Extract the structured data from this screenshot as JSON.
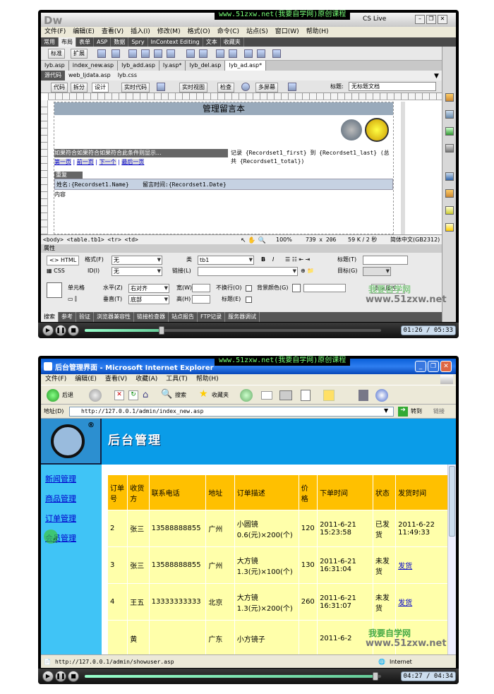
{
  "banner": "www.51zxw.net(我要自学网)原创课程",
  "watermark_url": "www.51zxw.net",
  "watermark_name": "我要自学网",
  "dw": {
    "logo": "Dw",
    "cslive": "CS Live",
    "menu": [
      "文件(F)",
      "编辑(E)",
      "查看(V)",
      "插入(I)",
      "修改(M)",
      "格式(O)",
      "命令(C)",
      "站点(S)",
      "窗口(W)",
      "帮助(H)"
    ],
    "insert_tabs": [
      "常用",
      "布局",
      "表单",
      "ASP",
      "数据",
      "Spry",
      "InContext Editing",
      "文本",
      "收藏夹"
    ],
    "tool_standard": "标准",
    "tool_extend": "扩展",
    "doc_tabs": [
      "lyb.asp",
      "index_new.asp",
      "lyb_add.asp",
      "ly.asp*",
      "lyb_del.asp",
      "lyb_ad.asp*"
    ],
    "doc_path": "源代码",
    "related": [
      "web_ljdata.asp",
      "lyb.css"
    ],
    "view_buttons": [
      "代码",
      "拆分",
      "设计",
      "实时代码",
      "实时视图",
      "检查",
      "多屏幕"
    ],
    "title_label": "标题:",
    "title_value": "无标题文档",
    "design": {
      "heading": "管理留言本",
      "repeat_text": "如果符合如果符合如果符合此条件则显示...",
      "nav_links": [
        "第一页",
        "前一页",
        "下一个",
        "最后一页"
      ],
      "record_text": "记录 {Recordset1_first} 到 {Recordset1_last} (总共 {Recordset1_total})",
      "repeat_label": "重复",
      "name_field": "姓名:{Recordset1.Name}",
      "time_field": "留言时间:{Recordset1.Date}",
      "content_label": "内容"
    },
    "tag_path": "<body> <table.tb1> <tr> <td>",
    "status": "100%",
    "size": "739 x 206",
    "filesize": "59 K / 2 秒",
    "encoding": "简体中文(GB2312)",
    "props_title": "属性",
    "props": {
      "html": "HTML",
      "css": "CSS",
      "format_label": "格式(F)",
      "format_value": "无",
      "class_label": "类",
      "class_value": "tb1",
      "id_label": "ID(I)",
      "id_value": "无",
      "link_label": "链接(L)",
      "title_label": "标题(T)",
      "target_label": "目标(G)",
      "cell_label": "单元格",
      "halign_label": "水平(Z)",
      "halign_value": "右对齐",
      "valign_label": "垂直(T)",
      "valign_value": "底部",
      "width_label": "宽(W)",
      "height_label": "高(H)",
      "nowrap_label": "不换行(O)",
      "header_label": "标题(E)",
      "bg_label": "背景颜色(G)",
      "page_props": "页面属性..."
    },
    "bottom_tabs": [
      "搜索",
      "参考",
      "验证",
      "浏览器兼容性",
      "链接检查器",
      "站点报告",
      "FTP记录",
      "服务器调试"
    ],
    "time": "01:26 / 05:33",
    "progress": 0.26
  },
  "ie": {
    "title": "后台管理界面 - Microsoft Internet Explorer",
    "menu": [
      "文件(F)",
      "编辑(E)",
      "查看(V)",
      "收藏(A)",
      "工具(T)",
      "帮助(H)"
    ],
    "back": "后退",
    "search": "搜索",
    "favorites": "收藏夹",
    "address_label": "地址(D)",
    "address": "http://127.0.0.1/admin/index_new.asp",
    "go": "转到",
    "links": "链接",
    "admin_title": "后台管理",
    "nav": [
      "新闻管理",
      "商品管理",
      "订单管理",
      "会员管理"
    ],
    "headers": [
      "订单号",
      "收货方",
      "联系电话",
      "地址",
      "订单描述",
      "价格",
      "下单时间",
      "状态",
      "发货时间"
    ],
    "rows": [
      [
        "2",
        "张三",
        "13588888855",
        "广州",
        "小圆镜0.6(元)×200(个)",
        "120",
        "2011-6-21 15:23:58",
        "已发货",
        "2011-6-22 11:49:33"
      ],
      [
        "3",
        "张三",
        "13588888855",
        "广州",
        "大方镜1.3(元)×100(个)",
        "130",
        "2011-6-21 16:31:04",
        "未发货",
        "发货"
      ],
      [
        "4",
        "王五",
        "13333333333",
        "北京",
        "大方镜1.3(元)×200(个)",
        "260",
        "2011-6-21 16:31:07",
        "未发货",
        "发货"
      ],
      [
        "",
        "黄",
        "",
        "广东",
        "小方镜子",
        "",
        "2011-6-2",
        "",
        ""
      ]
    ],
    "status_url": "http://127.0.0.1/admin/showuser.asp",
    "zone": "Internet",
    "time": "04:27 / 04:34",
    "progress": 0.98
  }
}
